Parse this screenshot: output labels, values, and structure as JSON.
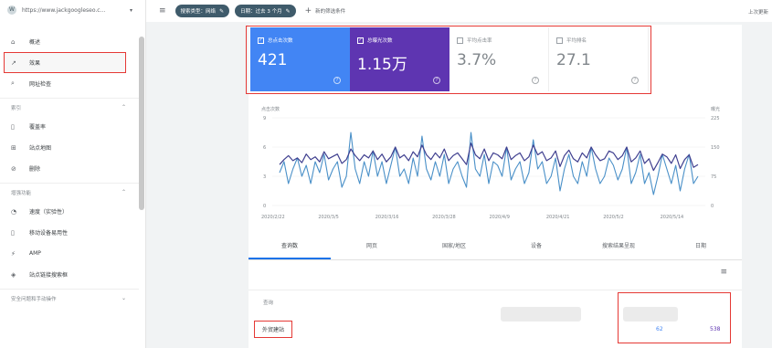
{
  "sidebar": {
    "property": "https://www.jackgoogleseo.c...",
    "items_top": [
      {
        "icon": "home-icon",
        "glyph": "⌂",
        "label": "概述"
      },
      {
        "icon": "trending-icon",
        "glyph": "↗",
        "label": "效果"
      },
      {
        "icon": "search-icon",
        "glyph": "⌕",
        "label": "网址检查"
      }
    ],
    "section_index": "索引",
    "items_index": [
      {
        "icon": "file-icon",
        "glyph": "▯",
        "label": "覆盖率"
      },
      {
        "icon": "sitemap-icon",
        "glyph": "⊞",
        "label": "站点地图"
      },
      {
        "icon": "remove-icon",
        "glyph": "⊘",
        "label": "删除"
      }
    ],
    "section_enhance": "增强功能",
    "items_enhance": [
      {
        "icon": "speed-icon",
        "glyph": "◔",
        "label": "速度（实验性）"
      },
      {
        "icon": "mobile-icon",
        "glyph": "▯",
        "label": "移动设备易用性"
      },
      {
        "icon": "amp-icon",
        "glyph": "⚡",
        "label": "AMP"
      },
      {
        "icon": "layers-icon",
        "glyph": "◈",
        "label": "站点链接搜索框"
      }
    ],
    "section_security": "安全问题和手动操作"
  },
  "topbar": {
    "chip1": "搜索类型：网络",
    "chip2": "日期：过去 3 个月",
    "new_filter": "新的筛选条件",
    "updated": "上次更新"
  },
  "metrics": [
    {
      "label": "总点击次数",
      "value": "421",
      "checked": true
    },
    {
      "label": "总曝光次数",
      "value": "1.15万",
      "checked": true
    },
    {
      "label": "平均点击率",
      "value": "3.7%",
      "checked": false
    },
    {
      "label": "平均排名",
      "value": "27.1",
      "checked": false
    }
  ],
  "chart_data": {
    "type": "line",
    "y_left_label": "点击次数",
    "y_right_label": "曝光",
    "y_left_ticks": [
      "9",
      "6",
      "3",
      "0"
    ],
    "y_right_ticks": [
      "225",
      "150",
      "75",
      "0"
    ],
    "ylim_left": [
      0,
      12
    ],
    "ylim_right": [
      0,
      225
    ],
    "x_ticks": [
      "2020/2/22",
      "2020/3/5",
      "2020/3/16",
      "2020/3/28",
      "2020/4/9",
      "2020/4/21",
      "2020/5/2",
      "2020/5/14"
    ],
    "colors": {
      "clicks": "#4a90c8",
      "impressions": "#3f3f8f"
    },
    "series": [
      {
        "values": [
          4.5,
          6,
          3,
          5,
          6.5,
          4,
          5.5,
          3,
          6,
          4.5,
          7,
          3.5,
          5,
          6,
          2.5,
          4,
          10,
          5,
          3,
          6,
          4,
          7.5,
          4,
          6,
          3,
          5.5,
          8,
          4,
          5,
          3,
          6.5,
          4,
          9.5,
          5,
          3.5,
          6,
          4,
          7,
          3,
          5,
          6,
          4,
          2.5,
          10,
          5,
          4,
          7,
          3,
          6,
          5.5,
          4,
          8,
          3.5,
          5,
          6,
          3,
          4.5,
          9,
          5,
          6,
          3,
          4,
          6.5,
          2,
          5,
          7,
          4,
          3,
          6,
          4,
          8,
          5,
          3,
          4,
          6.5,
          5.5,
          3.5,
          5,
          8,
          3,
          4.5,
          7,
          3,
          4.5,
          1.5,
          4,
          7,
          5,
          3,
          5.5,
          2,
          5,
          7,
          3,
          4
        ]
      },
      {
        "values": [
          105,
          118,
          128,
          115,
          122,
          110,
          132,
          118,
          125,
          112,
          138,
          120,
          126,
          132,
          108,
          118,
          145,
          128,
          115,
          130,
          122,
          140,
          118,
          132,
          112,
          125,
          150,
          122,
          130,
          115,
          138,
          125,
          155,
          130,
          118,
          135,
          122,
          145,
          115,
          128,
          135,
          120,
          105,
          160,
          130,
          120,
          145,
          115,
          135,
          130,
          120,
          150,
          118,
          128,
          135,
          115,
          125,
          155,
          130,
          138,
          115,
          122,
          140,
          100,
          128,
          142,
          120,
          112,
          135,
          122,
          150,
          130,
          115,
          120,
          140,
          135,
          118,
          128,
          150,
          112,
          122,
          140,
          108,
          120,
          90,
          110,
          132,
          125,
          108,
          130,
          95,
          118,
          130,
          98,
          105
        ]
      }
    ]
  },
  "tabs": [
    "查询数",
    "网页",
    "国家/地区",
    "设备",
    "搜索结果呈现",
    "日期"
  ],
  "table": {
    "query_header": "查询",
    "row_query": "外贸建站",
    "row_clicks": "62",
    "row_impressions": "538"
  }
}
